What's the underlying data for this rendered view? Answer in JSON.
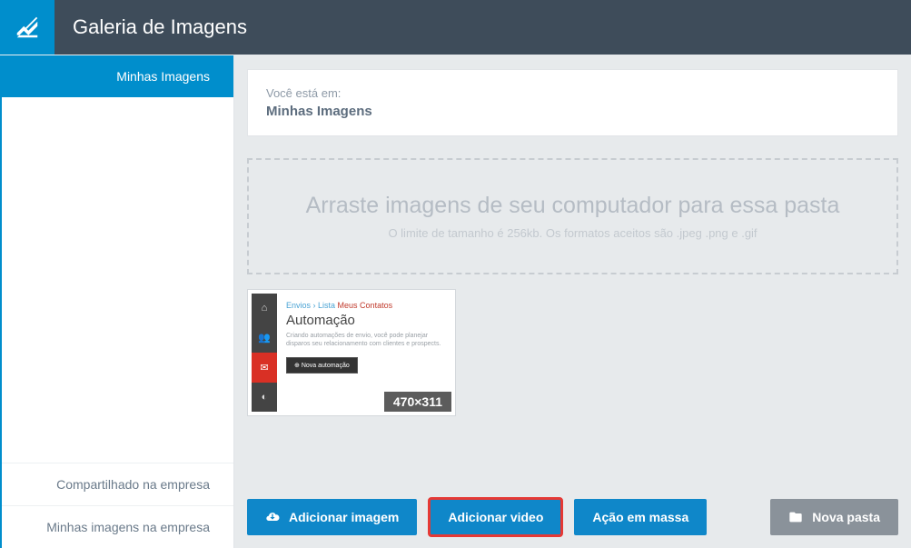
{
  "header": {
    "title": "Galeria de Imagens"
  },
  "sidebar": {
    "active": "Minhas Imagens",
    "bottom": [
      "Compartilhado na empresa",
      "Minhas imagens na empresa"
    ]
  },
  "breadcrumb": {
    "label": "Você está em:",
    "current": "Minhas Imagens"
  },
  "dropzone": {
    "title": "Arraste imagens de seu computador para essa pasta",
    "sub": "O limite de tamanho é 256kb. Os formatos aceitos são .jpeg .png e .gif"
  },
  "thumb": {
    "crumb1": "Envios",
    "crumb2": "Lista",
    "crumb3": "Meus Contatos",
    "title": "Automação",
    "desc": "Criando automações de envio, você pode planejar disparos seu relacionamento com clientes e prospects.",
    "button": "Nova automação",
    "dims": "470×311"
  },
  "actions": {
    "add_image": "Adicionar imagem",
    "add_video": "Adicionar video",
    "bulk": "Ação em massa",
    "new_folder": "Nova pasta"
  }
}
